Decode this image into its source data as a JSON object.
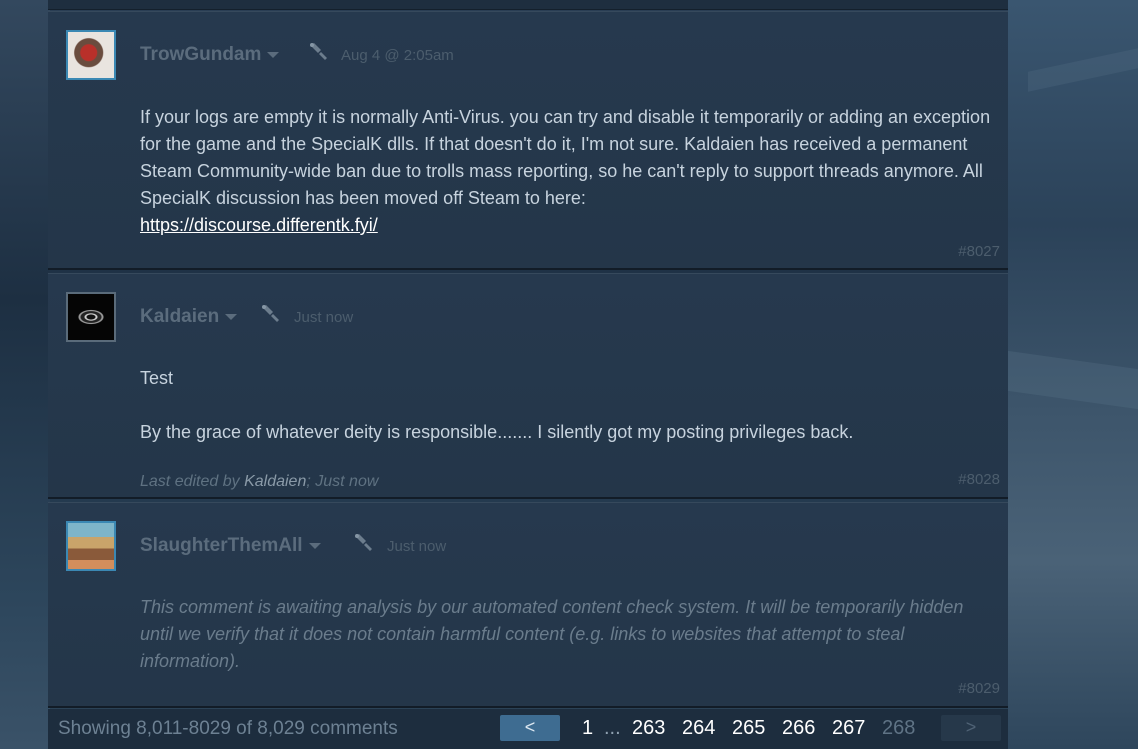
{
  "comments": [
    {
      "author": "TrowGundam",
      "timestamp": "Aug 4 @ 2:05am",
      "paragraphs": [
        "If your logs are empty it is normally Anti-Virus. you can try and disable it temporarily or adding an exception for the game and the SpecialK dlls. If that doesn't do it, I'm not sure. Kaldaien has received a permanent Steam Community-wide ban due to trolls mass reporting, so he can't reply to support threads anymore. All SpecialK discussion has been moved off Steam to here:"
      ],
      "link": "https://discourse.differentk.fyi/",
      "post_number": "#8027"
    },
    {
      "author": "Kaldaien",
      "timestamp": "Just now",
      "paragraphs": [
        "Test",
        "By the grace of whatever deity is responsible....... I silently got my posting privileges back."
      ],
      "edited_prefix": "Last edited by ",
      "edited_by": "Kaldaien",
      "edited_suffix": "; Just now",
      "post_number": "#8028"
    },
    {
      "author": "SlaughterThemAll",
      "timestamp": "Just now",
      "notice": "This comment is awaiting analysis by our automated content check system. It will be temporarily hidden until we verify that it does not contain harmful content (e.g. links to websites that attempt to steal information).",
      "post_number": "#8029"
    }
  ],
  "footer": {
    "showing": "Showing 8,011-8029 of 8,029 comments",
    "prev_label": "<",
    "next_label": ">",
    "ellipsis": "...",
    "pages": [
      "1",
      "263",
      "264",
      "265",
      "266",
      "267",
      "268"
    ],
    "current_page": "268"
  },
  "icons": {
    "award": "award-icon",
    "dropdown": "caret-down-icon"
  },
  "colors": {
    "link": "#ffffff",
    "prev_button": "#3e6c91",
    "panel": "#26394e"
  }
}
